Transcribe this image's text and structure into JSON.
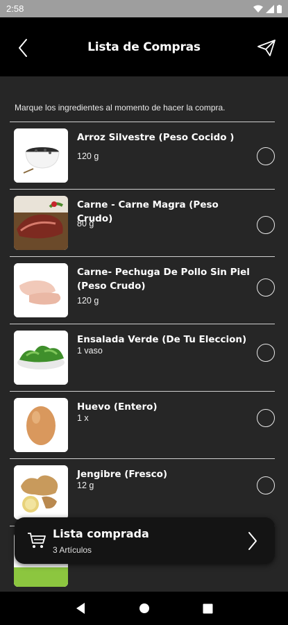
{
  "status_bar": {
    "time": "2:58"
  },
  "header": {
    "title": "Lista de Compras",
    "back_icon": "chevron-left-icon",
    "send_icon": "paper-plane-icon"
  },
  "instruction": "Marque los ingredientes al momento de hacer la compra.",
  "items": [
    {
      "name": "Arroz Silvestre (Peso Cocido )",
      "qty": "120 g",
      "image": "wild-rice-bowl"
    },
    {
      "name": "Carne - Carne Magra (Peso Crudo)",
      "qty": "80 g",
      "image": "lean-beef"
    },
    {
      "name": "Carne- Pechuga De Pollo Sin Piel (Peso Crudo)",
      "qty": "120 g",
      "image": "chicken-breast"
    },
    {
      "name": "Ensalada Verde (De Tu Eleccion)",
      "qty": "1 vaso",
      "image": "green-salad"
    },
    {
      "name": "Huevo (Entero)",
      "qty": "1 x",
      "image": "egg"
    },
    {
      "name": "Jengibre (Fresco)",
      "qty": "12 g",
      "image": "ginger"
    },
    {
      "image": "partial-item"
    }
  ],
  "bottom_card": {
    "title": "Lista comprada",
    "count": "3 Artículos",
    "icon": "shopping-cart-icon"
  },
  "colors": {
    "background": "#262626",
    "header": "#000000",
    "status_bar": "#9e9e9e",
    "card": "#141414"
  }
}
